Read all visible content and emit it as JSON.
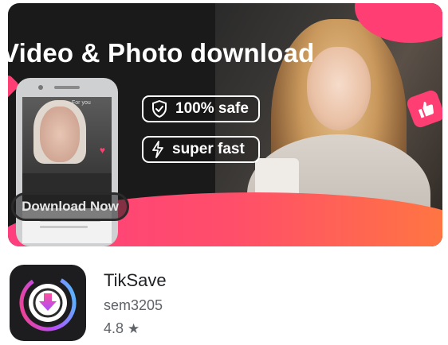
{
  "banner": {
    "headline": "Video & Photo download",
    "badge_safe": "100% safe",
    "badge_fast": "super fast",
    "download_button": "Download Now",
    "phone_tab": "For you"
  },
  "app": {
    "name": "TikSave",
    "developer": "sem3205",
    "rating": "4.8",
    "rating_icon": "star-icon"
  },
  "colors": {
    "accent_pink": "#ff3f73",
    "accent_orange": "#ff7a3d",
    "title_text": "#202124",
    "secondary_text": "#5f6368"
  }
}
